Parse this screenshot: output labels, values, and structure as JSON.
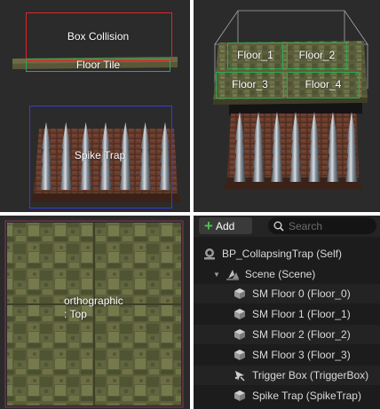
{
  "viewport1": {
    "box_label": "Box Collision",
    "floor_label": "Floor Tile",
    "spike_label": "Spike Trap",
    "colors": {
      "box": "#e0262a",
      "floor": "#2ea84a",
      "spike": "#3a3ad6"
    }
  },
  "viewport2": {
    "floor_labels": [
      "Floor_1",
      "Floor_2",
      "Floor_3",
      "Floor_4"
    ]
  },
  "viewport3": {
    "view_label": "orthographic",
    "view_sublabel": ": Top"
  },
  "outliner": {
    "add_label": "Add",
    "search_placeholder": "Search",
    "root": {
      "label": "BP_CollapsingTrap (Self)",
      "icon": "actor-icon"
    },
    "scene": {
      "label": "Scene (Scene)",
      "icon": "scene-component-icon"
    },
    "items": [
      {
        "label": "SM Floor 0 (Floor_0)",
        "icon": "static-mesh-icon"
      },
      {
        "label": "SM Floor 1 (Floor_1)",
        "icon": "static-mesh-icon"
      },
      {
        "label": "SM Floor 2 (Floor_2)",
        "icon": "static-mesh-icon"
      },
      {
        "label": "SM Floor 3 (Floor_3)",
        "icon": "static-mesh-icon"
      },
      {
        "label": "Trigger Box (TriggerBox)",
        "icon": "trigger-box-icon"
      },
      {
        "label": "Spike Trap (SpikeTrap)",
        "icon": "static-mesh-icon"
      }
    ]
  }
}
